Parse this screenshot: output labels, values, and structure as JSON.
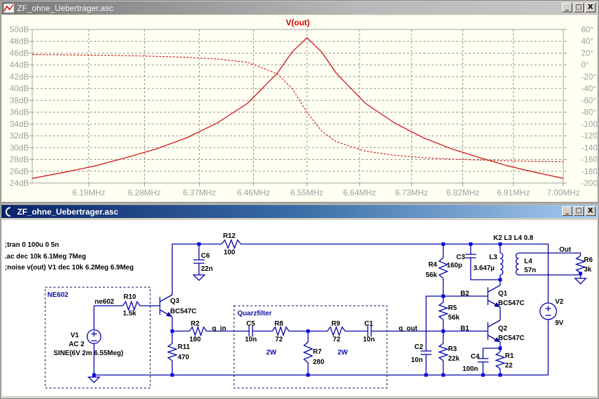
{
  "plot_window": {
    "title": "ZF_ohne_Uebertrager.asc",
    "buttons": {
      "minimize": "_",
      "maximize": "□",
      "close": "X"
    }
  },
  "chart_data": {
    "type": "line",
    "title": "V(out)",
    "x_scale": "log",
    "xlim": [
      6.1,
      7.0
    ],
    "x_unit": "MHz",
    "x_ticks": [
      "6.19MHz",
      "6.28MHz",
      "6.37MHz",
      "6.46MHz",
      "6.55MHz",
      "6.64MHz",
      "6.73MHz",
      "6.82MHz",
      "6.91MHz",
      "7.00MHz"
    ],
    "y_left": {
      "lim": [
        24,
        50
      ],
      "ticks": [
        "50dB",
        "48dB",
        "46dB",
        "44dB",
        "42dB",
        "40dB",
        "38dB",
        "36dB",
        "34dB",
        "32dB",
        "30dB",
        "28dB",
        "26dB",
        "24dB"
      ]
    },
    "y_right": {
      "lim": [
        -200,
        60
      ],
      "ticks": [
        "60°",
        "40°",
        "20°",
        "0°",
        "-20°",
        "-40°",
        "-60°",
        "-80°",
        "-100°",
        "-120°",
        "-140°",
        "-160°",
        "-180°",
        "-200°"
      ]
    },
    "grid": true,
    "x": [
      6.1,
      6.15,
      6.2,
      6.25,
      6.3,
      6.35,
      6.4,
      6.45,
      6.5,
      6.525,
      6.55,
      6.575,
      6.6,
      6.65,
      6.7,
      6.75,
      6.8,
      6.85,
      6.9,
      6.95,
      7.0
    ],
    "series": [
      {
        "quantity": "magnitude_dB",
        "style": "solid",
        "values": [
          24.8,
          25.8,
          26.9,
          28.3,
          29.8,
          31.7,
          34.2,
          37.5,
          42.6,
          46.2,
          48.6,
          46.2,
          42.6,
          37.5,
          34.2,
          31.7,
          29.8,
          28.3,
          26.9,
          25.8,
          24.8
        ]
      },
      {
        "quantity": "phase_deg",
        "style": "dashed",
        "values": [
          17.6,
          17.1,
          16.5,
          15.7,
          14.5,
          12.8,
          10.0,
          4.5,
          -15,
          -40,
          -80,
          -112,
          -130,
          -146,
          -153,
          -157,
          -159.5,
          -161,
          -162.5,
          -163.2,
          -163.8
        ]
      }
    ],
    "color": "#cc0000"
  },
  "schematic_window": {
    "title": "ZF_ohne_Uebertrager.asc",
    "buttons": {
      "minimize": "_",
      "maximize": "□",
      "close": "X"
    },
    "directives": [
      ";tran 0 100u 0 5n",
      ".ac dec 10k 6.1Meg 7Meg",
      ";noise v(out) V1 dec 10k 6.2Meg 6.9Meg"
    ],
    "coupling": "K2 L3 L4 0.8",
    "boxes": {
      "ne602": "NE602",
      "quarz": "Quarzfilter"
    },
    "nets": {
      "ne602": "ne602",
      "q_in": "q_in",
      "q_out": "q_out",
      "b1": "B1",
      "b2": "B2",
      "out": "Out"
    },
    "components": {
      "R12": {
        "name": "R12",
        "value": "100"
      },
      "C6": {
        "name": "C6",
        "value": "22n"
      },
      "R10": {
        "name": "R10",
        "value": "1.5k"
      },
      "Q3": {
        "name": "Q3",
        "value": "BC547C"
      },
      "V1": {
        "name": "V1",
        "value": "AC 2",
        "extra": "SINE(6V 2m 6.55Meg)"
      },
      "R2": {
        "name": "R2",
        "value": "180"
      },
      "R11": {
        "name": "R11",
        "value": "470"
      },
      "C5": {
        "name": "C5",
        "value": "10n"
      },
      "R8": {
        "name": "R8",
        "value": "72",
        "power": "2W"
      },
      "R7": {
        "name": "R7",
        "value": "280"
      },
      "R9": {
        "name": "R9",
        "value": "72",
        "power": "2W"
      },
      "C1": {
        "name": "C1",
        "value": "10n"
      },
      "R4": {
        "name": "R4",
        "value": "56k"
      },
      "C3": {
        "name": "C3",
        "value": "160p"
      },
      "L3": {
        "name": "L3",
        "value": "3.647µ"
      },
      "L4": {
        "name": "L4",
        "value": "57n"
      },
      "R6": {
        "name": "R6",
        "value": "3k"
      },
      "Q1": {
        "name": "Q1",
        "value": "BC547C"
      },
      "Q2": {
        "name": "Q2",
        "value": "BC547C"
      },
      "R5": {
        "name": "R5",
        "value": "56k"
      },
      "C2": {
        "name": "C2",
        "value": "10n"
      },
      "R3": {
        "name": "R3",
        "value": "22k"
      },
      "C4": {
        "name": "C4",
        "value": "100n"
      },
      "R1": {
        "name": "R1",
        "value": "22"
      },
      "V2": {
        "name": "V2",
        "value": "9V"
      }
    }
  }
}
